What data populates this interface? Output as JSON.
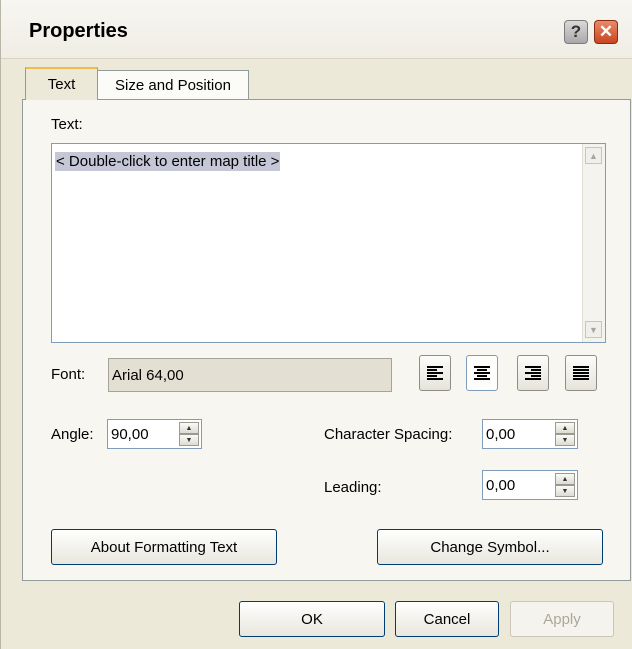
{
  "window": {
    "title": "Properties"
  },
  "tabs": [
    {
      "label": "Text"
    },
    {
      "label": "Size and Position"
    }
  ],
  "text_section": {
    "label": "Text:",
    "value": "< Double-click to enter map title >"
  },
  "font": {
    "label": "Font:",
    "value": "Arial 64,00"
  },
  "alignment": {
    "options": [
      "left",
      "center",
      "right",
      "justify"
    ],
    "selected": "center"
  },
  "angle": {
    "label": "Angle:",
    "value": "90,00"
  },
  "character_spacing": {
    "label": "Character Spacing:",
    "value": "0,00"
  },
  "leading": {
    "label": "Leading:",
    "value": "0,00"
  },
  "buttons": {
    "about": "About Formatting Text",
    "change_symbol": "Change Symbol...",
    "ok": "OK",
    "cancel": "Cancel",
    "apply": "Apply"
  },
  "title_buttons": {
    "help": "?",
    "close": "✕"
  },
  "arrows": {
    "up": "▲",
    "down": "▼"
  }
}
